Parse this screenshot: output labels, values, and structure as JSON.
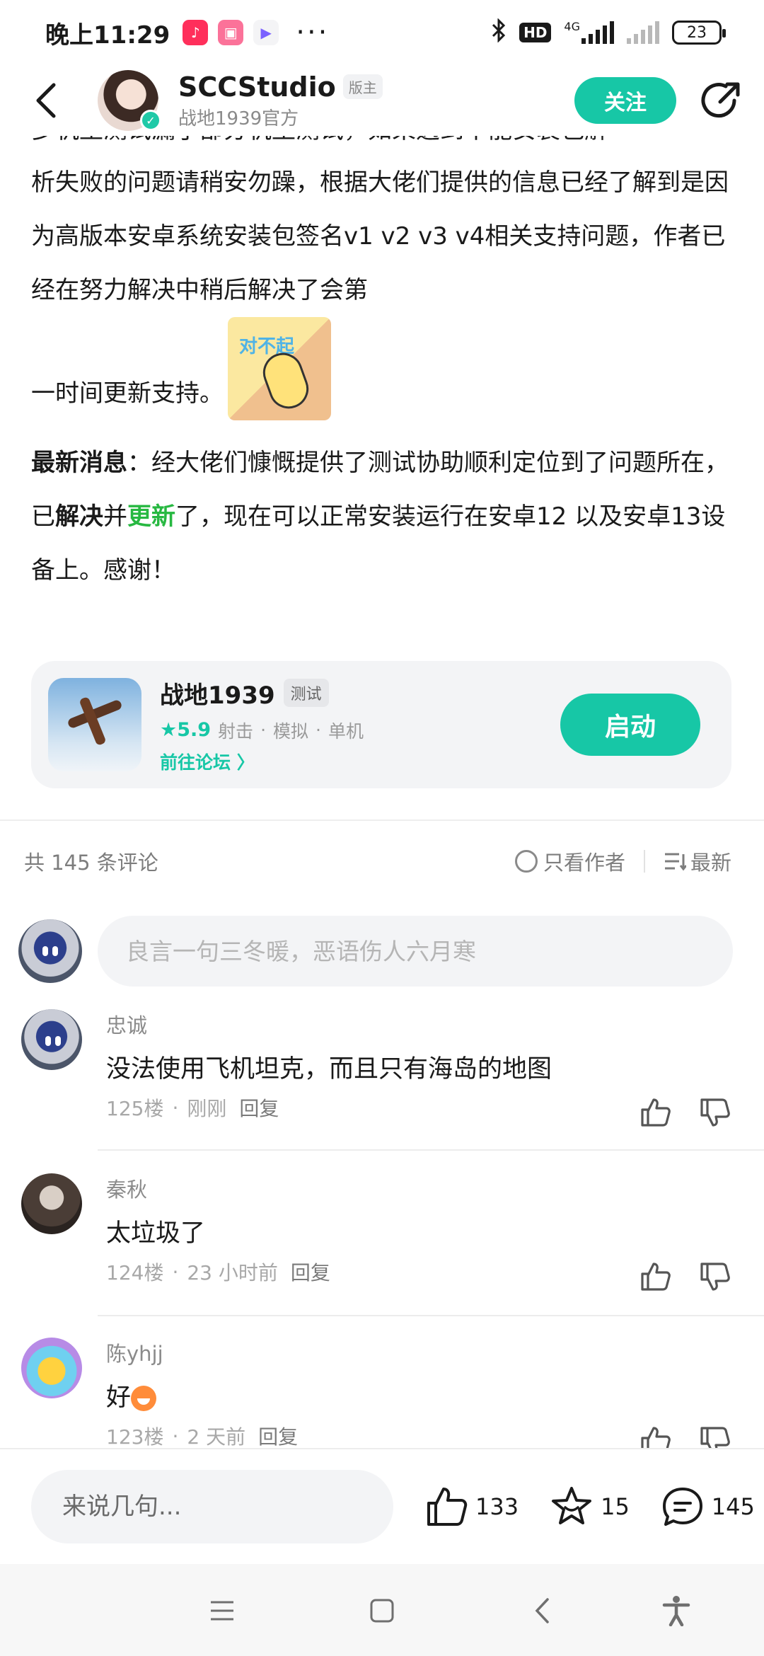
{
  "status_bar": {
    "time": "晚上11:29",
    "dots": "···",
    "hd": "HD",
    "network": "4G",
    "battery": "23"
  },
  "header": {
    "username": "SCCStudio",
    "role_badge": "版主",
    "subtitle": "战地1939官方",
    "follow_label": "关注"
  },
  "article": {
    "line1_clipped": "多机型测试漏了部分机型测试，如果遇到不能安装包解",
    "para1": "析失败的问题请稍安勿躁，根据大佬们提供的信息已经了解到是因为高版本安卓系统安装包签名v1 v2 v3 v4相关支持问题，作者已经在努力解决中稍后解决了会第",
    "para1_end": "一时间更新支持。",
    "sticker_text": "对不起",
    "news_label": "最新消息",
    "news_part1": "：经大佬们慷慨提供了测试协助顺利定位到了问题所在，已",
    "news_solved": "解决",
    "news_and": "并",
    "news_updated": "更新",
    "news_part2": "了，现在可以正常安装运行在安卓12 以及安卓13设备上。感谢！"
  },
  "app_card": {
    "name": "战地1939",
    "badge": "测试",
    "rating": "★5.9",
    "tags": [
      "射击",
      "模拟",
      "单机"
    ],
    "separator": "·",
    "forum_link": "前往论坛 〉",
    "launch_label": "启动"
  },
  "comments_header": {
    "count_text": "共 145 条评论",
    "author_only": "只看作者",
    "sort": "最新"
  },
  "comment_input": {
    "placeholder": "良言一句三冬暖，恶语伤人六月寒"
  },
  "comments": [
    {
      "user": "忠诚",
      "text": "没法使用飞机坦克，而且只有海岛的地图",
      "floor": "125楼",
      "time": "刚刚",
      "reply": "回复"
    },
    {
      "user": "秦秋",
      "text": "太垃圾了",
      "floor": "124楼",
      "time": "23 小时前",
      "reply": "回复"
    },
    {
      "user": "陈yhjj",
      "text": "好",
      "floor": "123楼",
      "time": "2 天前",
      "reply": "回复"
    }
  ],
  "meta_separator": "·",
  "bottom_bar": {
    "placeholder": "来说几句...",
    "likes": "133",
    "favorites": "15",
    "comments": "145"
  },
  "colors": {
    "accent": "#17c7a6",
    "update_green": "#27b841"
  }
}
